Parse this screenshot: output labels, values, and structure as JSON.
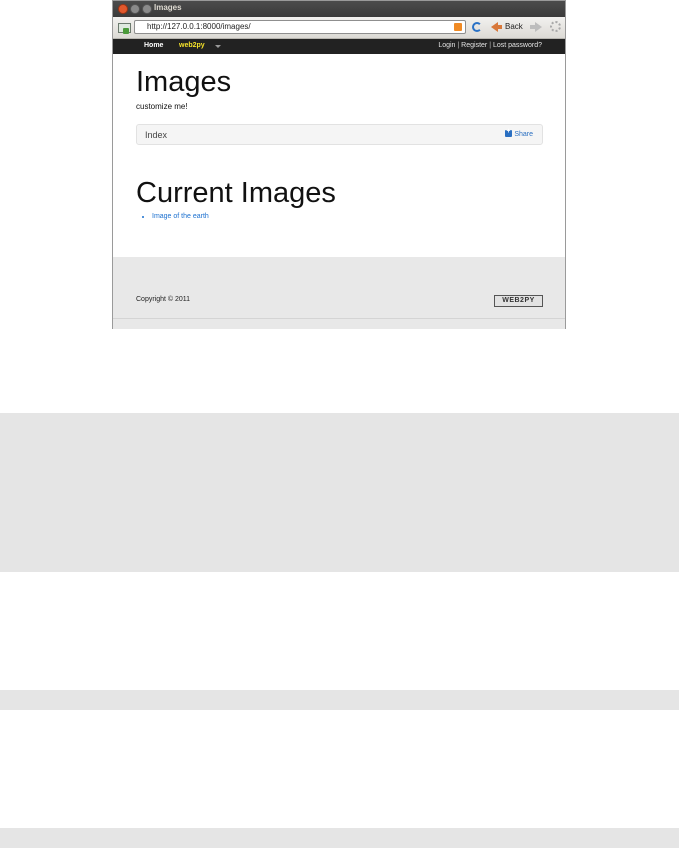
{
  "window": {
    "title": "Images"
  },
  "toolbar": {
    "url": "http://127.0.0.1:8000/images/",
    "back_label": "Back"
  },
  "nav": {
    "home": "Home",
    "brand": "web2py",
    "login": "Login",
    "register": "Register",
    "lost_password": "Lost password?",
    "separator": " | "
  },
  "page": {
    "heading": "Images",
    "subtitle": "customize me!",
    "breadcrumb": "Index",
    "share": "Share",
    "section_heading": "Current Images",
    "images": [
      "Image of the earth"
    ]
  },
  "footer": {
    "copyright": "Copyright © 2011",
    "badge": "WEB2PY"
  },
  "icons": {
    "close": "close-icon",
    "reload": "reload-icon",
    "back": "back-arrow-icon",
    "forward": "forward-arrow-icon",
    "settings": "gear-icon",
    "rss": "rss-icon",
    "share": "share-icon"
  }
}
